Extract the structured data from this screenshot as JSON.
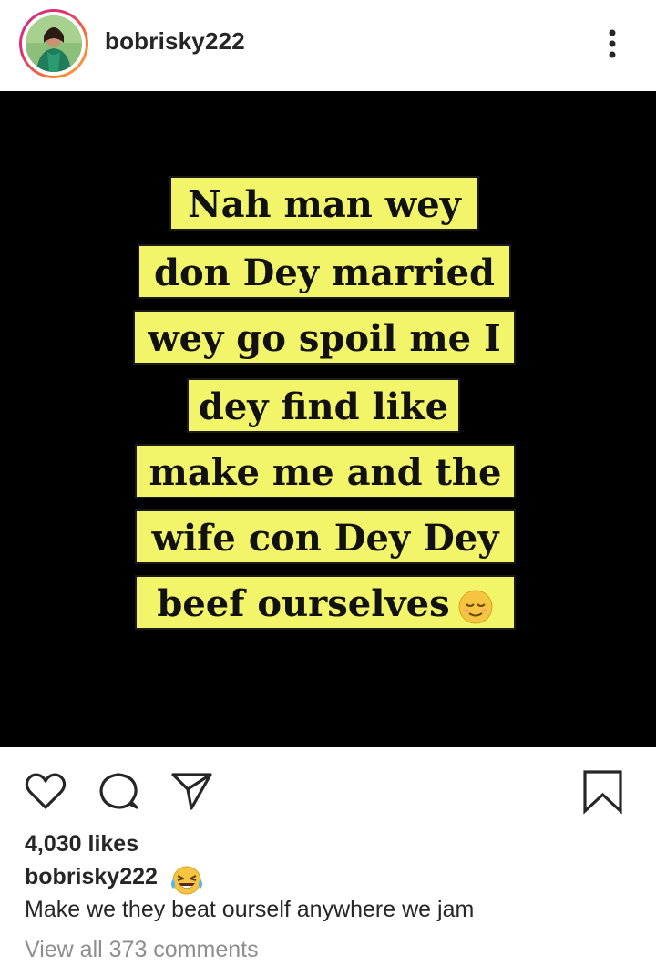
{
  "post": {
    "username": "bobrisky222",
    "image_lines": [
      "Nah man wey",
      "don Dey married",
      "wey go spoil me I",
      "dey find like",
      "make me and the",
      "wife con Dey Dey",
      "beef ourselves"
    ],
    "likes": "4,030 likes",
    "caption_username": "bobrisky222",
    "caption_text": "Make we they beat ourself anywhere we jam",
    "view_comments": "View all 373 comments"
  },
  "icons": {
    "more": "more-options-icon",
    "like": "heart-icon",
    "comment": "comment-icon",
    "share": "send-icon",
    "save": "bookmark-icon",
    "caption_emoji": "laughing-tears-emoji",
    "meme_emoji": "relieved-face-emoji"
  },
  "colors": {
    "highlight": "#f2f56a",
    "image_bg": "#000000",
    "text": "#262626",
    "muted": "#8e8e8e",
    "avatar_ring": "#e1306c"
  }
}
